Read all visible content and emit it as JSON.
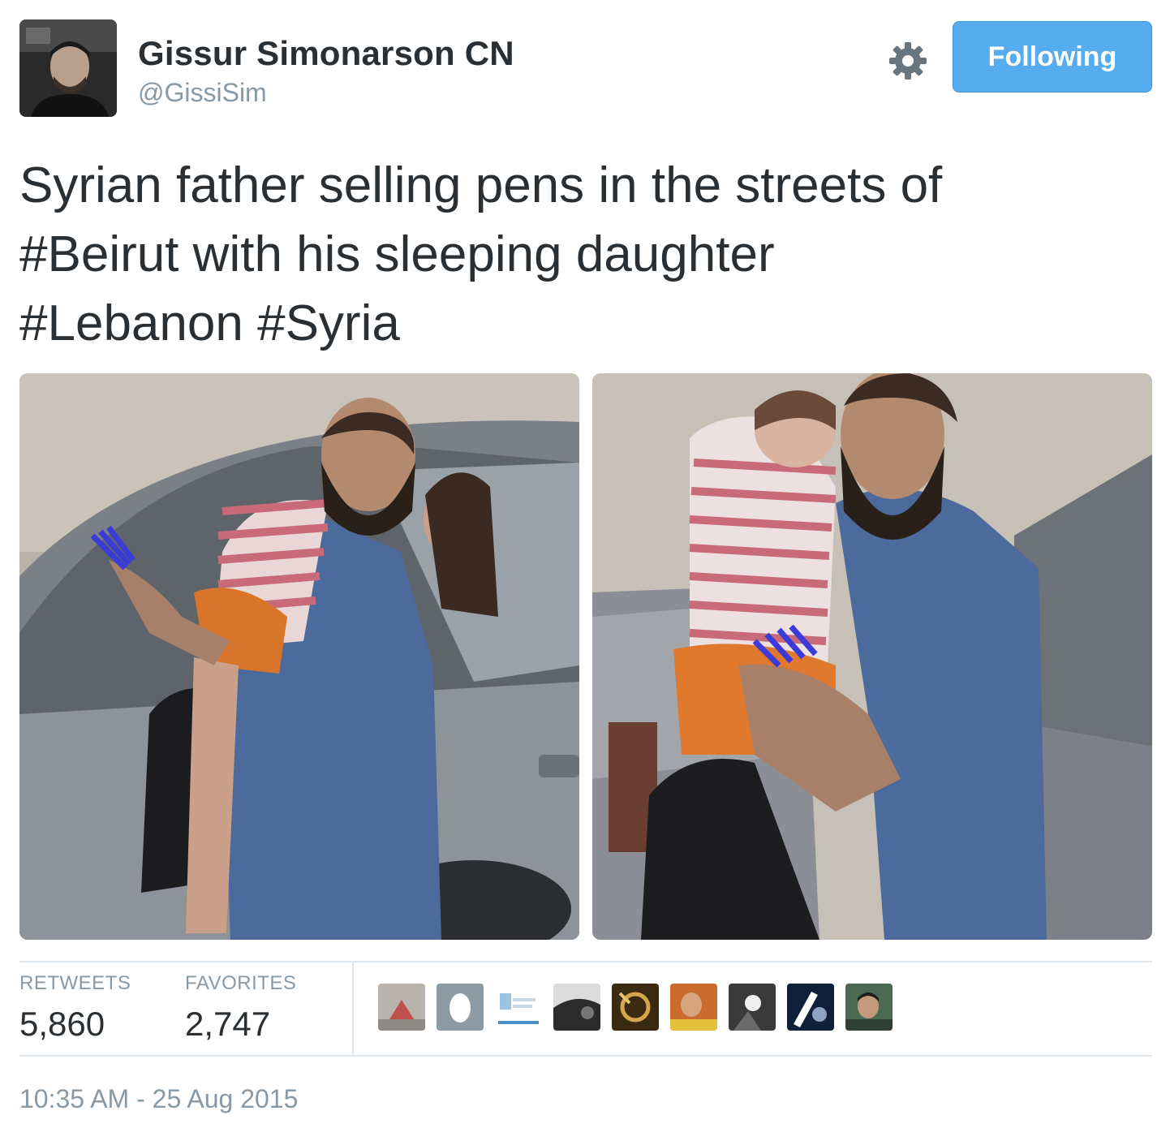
{
  "author": {
    "display_name": "Gissur Simonarson CN",
    "handle": "@GissiSim",
    "avatar_icon": "profile-photo"
  },
  "actions": {
    "settings_icon": "gear-icon",
    "follow_label": "Following",
    "accent_color": "#55acee"
  },
  "tweet": {
    "lines": [
      [
        "Syrian father selling pens in the streets of"
      ],
      [
        "#Beirut",
        " with his sleeping daughter"
      ],
      [
        "#Lebanon",
        " ",
        "#Syria"
      ]
    ]
  },
  "stats": {
    "retweets_label": "RETWEETS",
    "retweets_value": "5,860",
    "favorites_label": "FAVORITES",
    "favorites_value": "2,747",
    "favoriter_avatars": [
      "avatar-1",
      "avatar-2",
      "avatar-3",
      "avatar-4",
      "avatar-5",
      "avatar-6",
      "avatar-7",
      "avatar-8",
      "avatar-9"
    ]
  },
  "timestamp": "10:35 AM - 25 Aug 2015"
}
